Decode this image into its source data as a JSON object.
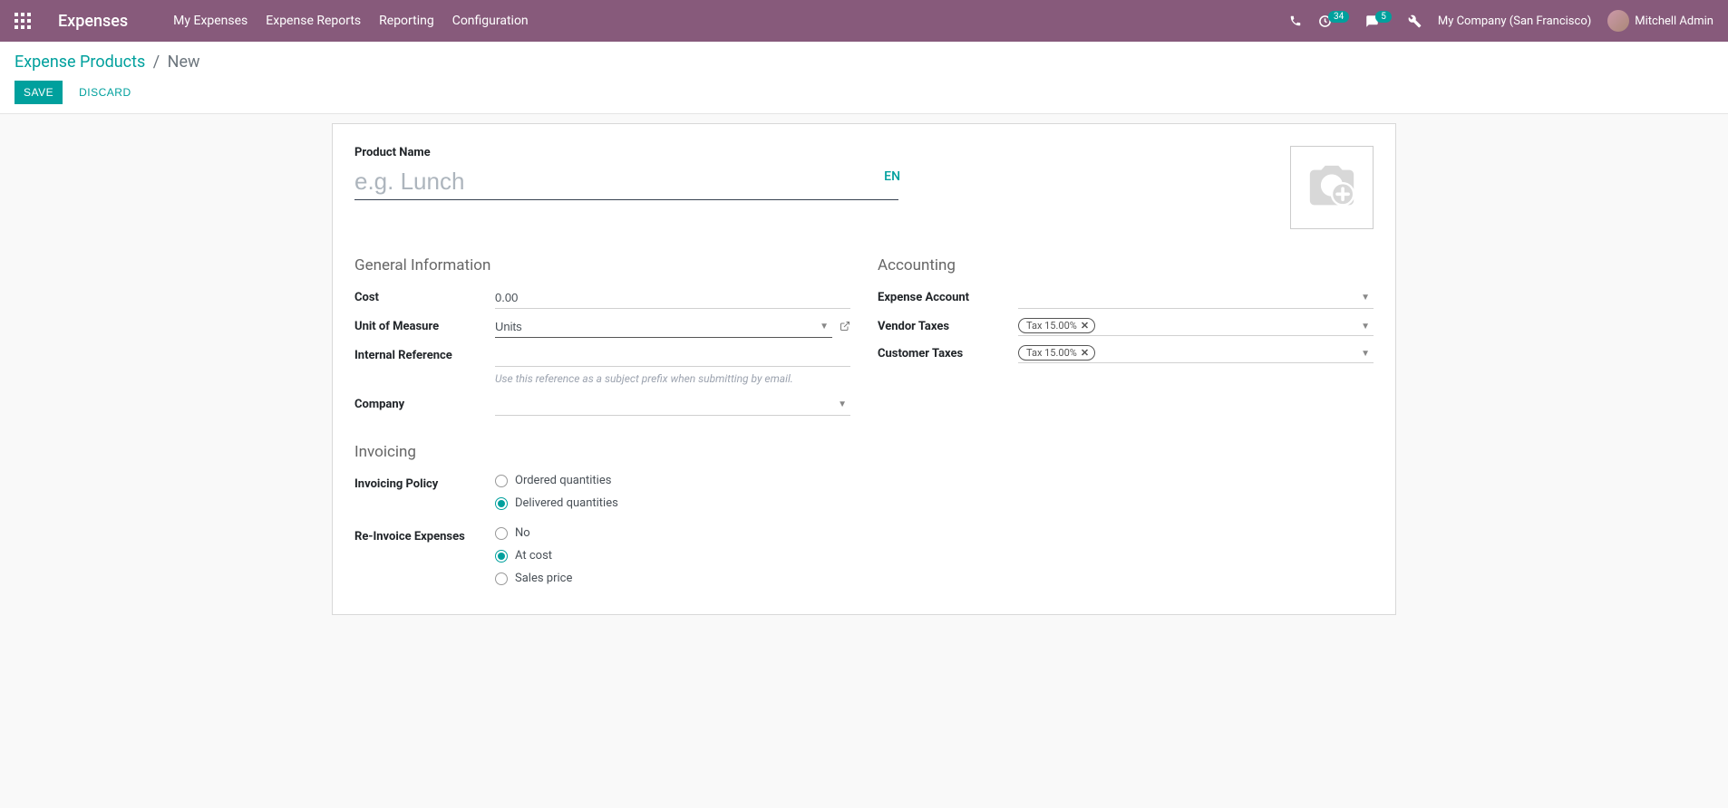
{
  "navbar": {
    "brand": "Expenses",
    "links": [
      "My Expenses",
      "Expense Reports",
      "Reporting",
      "Configuration"
    ],
    "badge_clock": "34",
    "badge_chat": "5",
    "company": "My Company (San Francisco)",
    "user": "Mitchell Admin"
  },
  "breadcrumb": {
    "parent": "Expense Products",
    "current": "New"
  },
  "buttons": {
    "save": "Save",
    "discard": "Discard"
  },
  "title": {
    "label": "Product Name",
    "placeholder": "e.g. Lunch",
    "lang": "EN"
  },
  "sections": {
    "general": "General Information",
    "accounting": "Accounting",
    "invoicing": "Invoicing"
  },
  "fields": {
    "cost": {
      "label": "Cost",
      "value": "0.00"
    },
    "uom": {
      "label": "Unit of Measure",
      "value": "Units"
    },
    "internal_ref": {
      "label": "Internal Reference",
      "value": "",
      "help": "Use this reference as a subject prefix when submitting by email."
    },
    "company": {
      "label": "Company",
      "value": ""
    },
    "expense_account": {
      "label": "Expense Account",
      "value": ""
    },
    "vendor_taxes": {
      "label": "Vendor Taxes",
      "tag": "Tax 15.00%"
    },
    "customer_taxes": {
      "label": "Customer Taxes",
      "tag": "Tax 15.00%"
    },
    "invoicing_policy": {
      "label": "Invoicing Policy",
      "options": [
        "Ordered quantities",
        "Delivered quantities"
      ],
      "selected": 1
    },
    "reinvoice": {
      "label": "Re-Invoice Expenses",
      "options": [
        "No",
        "At cost",
        "Sales price"
      ],
      "selected": 1
    }
  }
}
